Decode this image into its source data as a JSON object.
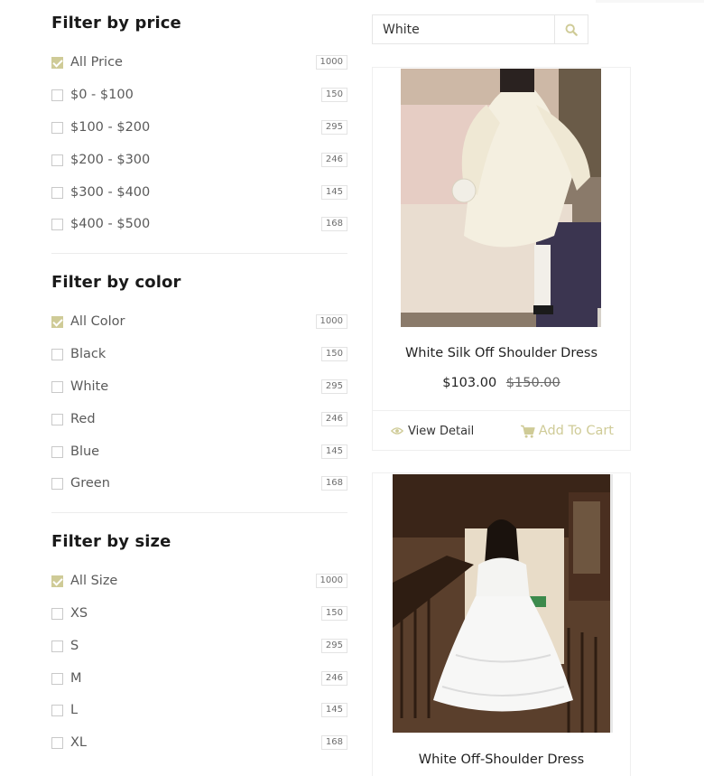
{
  "filters": {
    "price": {
      "title": "Filter by price",
      "items": [
        {
          "label": "All Price",
          "count": "1000",
          "checked": true
        },
        {
          "label": "$0 - $100",
          "count": "150",
          "checked": false
        },
        {
          "label": "$100 - $200",
          "count": "295",
          "checked": false
        },
        {
          "label": "$200 - $300",
          "count": "246",
          "checked": false
        },
        {
          "label": "$300 - $400",
          "count": "145",
          "checked": false
        },
        {
          "label": "$400 - $500",
          "count": "168",
          "checked": false
        }
      ]
    },
    "color": {
      "title": "Filter by color",
      "items": [
        {
          "label": "All Color",
          "count": "1000",
          "checked": true
        },
        {
          "label": "Black",
          "count": "150",
          "checked": false
        },
        {
          "label": "White",
          "count": "295",
          "checked": false
        },
        {
          "label": "Red",
          "count": "246",
          "checked": false
        },
        {
          "label": "Blue",
          "count": "145",
          "checked": false
        },
        {
          "label": "Green",
          "count": "168",
          "checked": false
        }
      ]
    },
    "size": {
      "title": "Filter by size",
      "items": [
        {
          "label": "All Size",
          "count": "1000",
          "checked": true
        },
        {
          "label": "XS",
          "count": "150",
          "checked": false
        },
        {
          "label": "S",
          "count": "295",
          "checked": false
        },
        {
          "label": "M",
          "count": "246",
          "checked": false
        },
        {
          "label": "L",
          "count": "145",
          "checked": false
        },
        {
          "label": "XL",
          "count": "168",
          "checked": false
        }
      ]
    }
  },
  "search": {
    "value": "White",
    "icon": "search-icon"
  },
  "products": [
    {
      "title": "White Silk Off Shoulder Dress",
      "price": "$103.00",
      "old_price": "$150.00",
      "view_label": "View Detail",
      "cart_label": "Add To Cart"
    },
    {
      "title": "White Off-Shoulder Dress"
    }
  ],
  "colors": {
    "accent": "#cfcb97",
    "border": "#efefef",
    "text": "#5a5a5a"
  }
}
